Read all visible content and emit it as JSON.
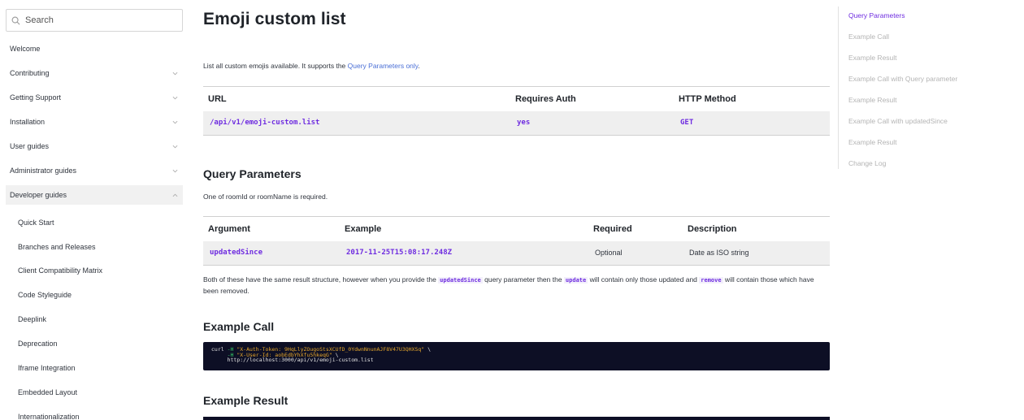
{
  "search": {
    "placeholder": "Search"
  },
  "sidebar": {
    "items": [
      {
        "label": "Welcome",
        "has_chevron": false
      },
      {
        "label": "Contributing",
        "has_chevron": true
      },
      {
        "label": "Getting Support",
        "has_chevron": true
      },
      {
        "label": "Installation",
        "has_chevron": true
      },
      {
        "label": "User guides",
        "has_chevron": true
      },
      {
        "label": "Administrator guides",
        "has_chevron": true
      },
      {
        "label": "Developer guides",
        "has_chevron": true,
        "expanded": true
      }
    ],
    "subitems": [
      "Quick Start",
      "Branches and Releases",
      "Client Compatibility Matrix",
      "Code Styleguide",
      "Deeplink",
      "Deprecation",
      "Iframe Integration",
      "Embedded Layout",
      "Internationalization"
    ]
  },
  "main": {
    "title": "Emoji custom list",
    "intro_text": "List all custom emojis available. It supports the ",
    "intro_link": "Query Parameters only",
    "intro_end": ".",
    "endpoint_table": {
      "headers": [
        "URL",
        "Requires Auth",
        "HTTP Method"
      ],
      "row": [
        "/api/v1/emoji-custom.list",
        "yes",
        "GET"
      ]
    },
    "query_params": {
      "heading": "Query Parameters",
      "note": "One of roomId or roomName is required.",
      "headers": [
        "Argument",
        "Example",
        "Required",
        "Description"
      ],
      "row": [
        "updatedSince",
        "2017-11-25T15:08:17.248Z",
        "Optional",
        "Date as ISO string"
      ]
    },
    "result_note": {
      "part1": "Both of these have the same result structure, however when you provide the ",
      "code1": "updatedSince",
      "part2": " query parameter then the ",
      "code2": "update",
      "part3": " will contain only those updated and ",
      "code3": "remove",
      "part4": " will contain those which have been removed."
    },
    "example_call": {
      "heading": "Example Call",
      "line1_cmd": "curl ",
      "line1_flag": "-H",
      "line1_str": "\"X-Auth-Token: 9HqLlyZOugoStsXCUfD_0YdwnNnunAJF8V47U3QHXSq\"",
      "line1_end": " \\",
      "line2_flag": "-H",
      "line2_str": "\"X-User-Id: aobEdbYhXfu5hkeqG\"",
      "line2_end": " \\",
      "line3": "http://localhost:3000/api/v1/emoji-custom.list"
    },
    "example_result": {
      "heading": "Example Result"
    }
  },
  "toc": {
    "items": [
      "Query Parameters",
      "Example Call",
      "Example Result",
      "Example Call with Query parameter",
      "Example Result",
      "Example Call with updatedSince",
      "Example Result",
      "Change Log"
    ],
    "active_index": 0
  },
  "colors": {
    "accent": "#6f2de0",
    "link": "#4a6fd6",
    "code_bg": "#0d0f25"
  }
}
